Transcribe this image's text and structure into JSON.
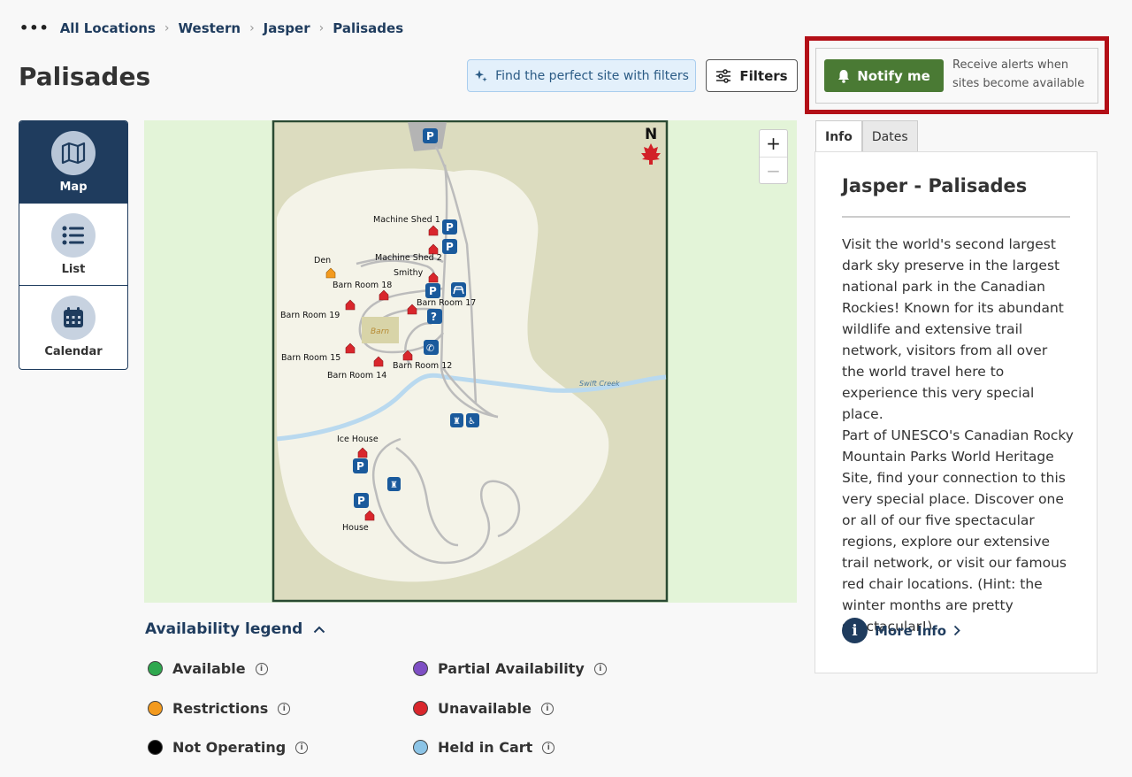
{
  "breadcrumb": {
    "items": [
      "All Locations",
      "Western",
      "Jasper",
      "Palisades"
    ]
  },
  "page": {
    "title": "Palisades"
  },
  "toolbar": {
    "find_label": "Find the perfect site with filters",
    "filters_label": "Filters"
  },
  "notify": {
    "button_label": "Notify me",
    "description": "Receive alerts when sites become available"
  },
  "views": [
    {
      "label": "Map",
      "icon": "map-icon",
      "active": true
    },
    {
      "label": "List",
      "icon": "list-icon",
      "active": false
    },
    {
      "label": "Calendar",
      "icon": "calendar-icon",
      "active": false
    }
  ],
  "map": {
    "north_label": "N",
    "creek_label": "Swift Creek",
    "barn_label": "Barn",
    "sites": [
      "Machine Shed 1",
      "Machine Shed 2",
      "Den",
      "Smithy",
      "Barn Room 18",
      "Barn Room 17",
      "Barn Room 19",
      "Barn Room 15",
      "Barn Room 14",
      "Barn Room 12",
      "Ice House",
      "House"
    ],
    "zoom_in": "+",
    "zoom_out": "−"
  },
  "legend": {
    "title": "Availability legend",
    "items": [
      {
        "label": "Available",
        "color": "#2fa84f"
      },
      {
        "label": "Partial Availability",
        "color": "#7e4fc4"
      },
      {
        "label": "Restrictions",
        "color": "#f39a1e"
      },
      {
        "label": "Unavailable",
        "color": "#d9262c"
      },
      {
        "label": "Not Operating",
        "color": "#000000"
      },
      {
        "label": "Held in Cart",
        "color": "#8cc4e6"
      }
    ]
  },
  "tabs": [
    "Info",
    "Dates"
  ],
  "info": {
    "title": "Jasper - Palisades",
    "desc1": "Visit the world's second largest dark sky preserve in the largest national park in the Canadian Rockies! Known for its abundant wildlife and extensive trail network, visitors from all over the world travel here to experience this very special place.",
    "desc2": "Part of UNESCO's Canadian Rocky Mountain Parks World Heritage Site, find your connection to this very special place. Discover one or all of our five spectacular regions, explore our extensive trail network, or visit our famous red chair locations. (Hint: the winter months are pretty spectacular!)",
    "more_info": "More Info"
  }
}
